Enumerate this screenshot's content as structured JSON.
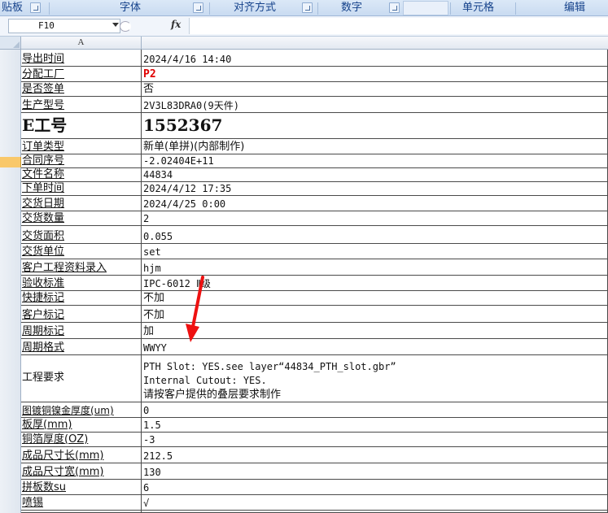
{
  "ribbon": {
    "groups": [
      {
        "label": "贴板"
      },
      {
        "label": "字体"
      },
      {
        "label": "对齐方式"
      },
      {
        "label": "数字"
      },
      {
        "label": "单元格"
      },
      {
        "label": "编辑"
      }
    ]
  },
  "formula_bar": {
    "name_box": "F10",
    "fx_symbol": "fx",
    "value": ""
  },
  "grid": {
    "column_headers": [
      "A"
    ],
    "rows": [
      {
        "label": "导出时间",
        "value": "2024/4/16 14:40"
      },
      {
        "label": "分配工厂",
        "value": "P2"
      },
      {
        "label": "是否签单",
        "value": "否"
      },
      {
        "label": "生产型号",
        "value": "2V3L83DRA0(9天件)"
      },
      {
        "label": "E工号",
        "value": "1552367"
      },
      {
        "label": "订单类型",
        "value": "新单(单拼)(内部制作)"
      },
      {
        "label": "合同序号",
        "value": "-2.02404E+11"
      },
      {
        "label": "文件名称",
        "value": "44834"
      },
      {
        "label": "下单时间",
        "value": "2024/4/12 17:35"
      },
      {
        "label": "交货日期",
        "value": "2024/4/25 0:00"
      },
      {
        "label": "交货数量",
        "value": "2"
      },
      {
        "label": "交货面积",
        "value": "0.055"
      },
      {
        "label": "交货单位",
        "value": "set"
      },
      {
        "label": "客户工程资料录入",
        "value": "hjm"
      },
      {
        "label": "验收标准",
        "value": "IPC-6012 Ⅱ级"
      },
      {
        "label": "快捷标记",
        "value": "不加"
      },
      {
        "label": "客户标记",
        "value": "不加"
      },
      {
        "label": "周期标记",
        "value": "加"
      },
      {
        "label": "周期格式",
        "value": "WWYY"
      },
      {
        "label": "工程要求",
        "lines": [
          "PTH Slot: YES.see layer“44834_PTH_slot.gbr”",
          "Internal Cutout: YES.",
          "请按客户提供的叠层要求制作"
        ]
      },
      {
        "label": "图镀铜镍金厚度(um)",
        "value": "0"
      },
      {
        "label": "板厚(mm)",
        "value": "1.5"
      },
      {
        "label": "铜箔厚度(OZ)",
        "value": "-3"
      },
      {
        "label": "成品尺寸长(mm)",
        "value": "212.5"
      },
      {
        "label": "成品尺寸宽(mm)",
        "value": "130"
      },
      {
        "label": "拼板数su",
        "value": "6"
      },
      {
        "label": "喷锡",
        "value": "√"
      }
    ]
  },
  "annotation": {
    "color": "#ee1111"
  }
}
